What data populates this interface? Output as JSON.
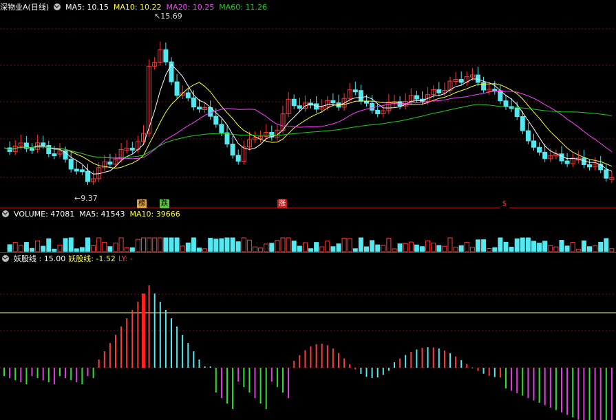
{
  "main": {
    "title": "深物业A(日线)",
    "ma5": "MA5: 10.15",
    "ma10": "MA10: 10.22",
    "ma20": "MA20: 10.25",
    "ma60": "MA60: 11.26",
    "high_label": "15.69",
    "low_label": "9.37",
    "tags": [
      {
        "text": "榜",
        "bg": "#d6a04a",
        "fg": "#000"
      },
      {
        "text": "跌",
        "bg": "#5fbf3f",
        "fg": "#000"
      },
      {
        "text": "涨",
        "bg": "#c02020",
        "fg": "#fff"
      },
      {
        "text": "$",
        "bg": "#000",
        "fg": "#ff4040"
      }
    ]
  },
  "volume": {
    "label": "VOLUME: 47081",
    "ma5": "MA5: 41543",
    "ma10": "MA10: 39666"
  },
  "indicator": {
    "label": "妖股线 : 15.00",
    "line": "妖股线: -1.52",
    "ly": "LY: -"
  },
  "colors": {
    "up": "#ff3a3a",
    "down": "#54e8f0",
    "ma5": "#ffffff",
    "ma10": "#ffff40",
    "ma20": "#ff40ff",
    "ma60": "#20d020",
    "grid": "#7a1010",
    "osc_magenta": "#e040e0",
    "osc_green": "#30e030"
  }
}
